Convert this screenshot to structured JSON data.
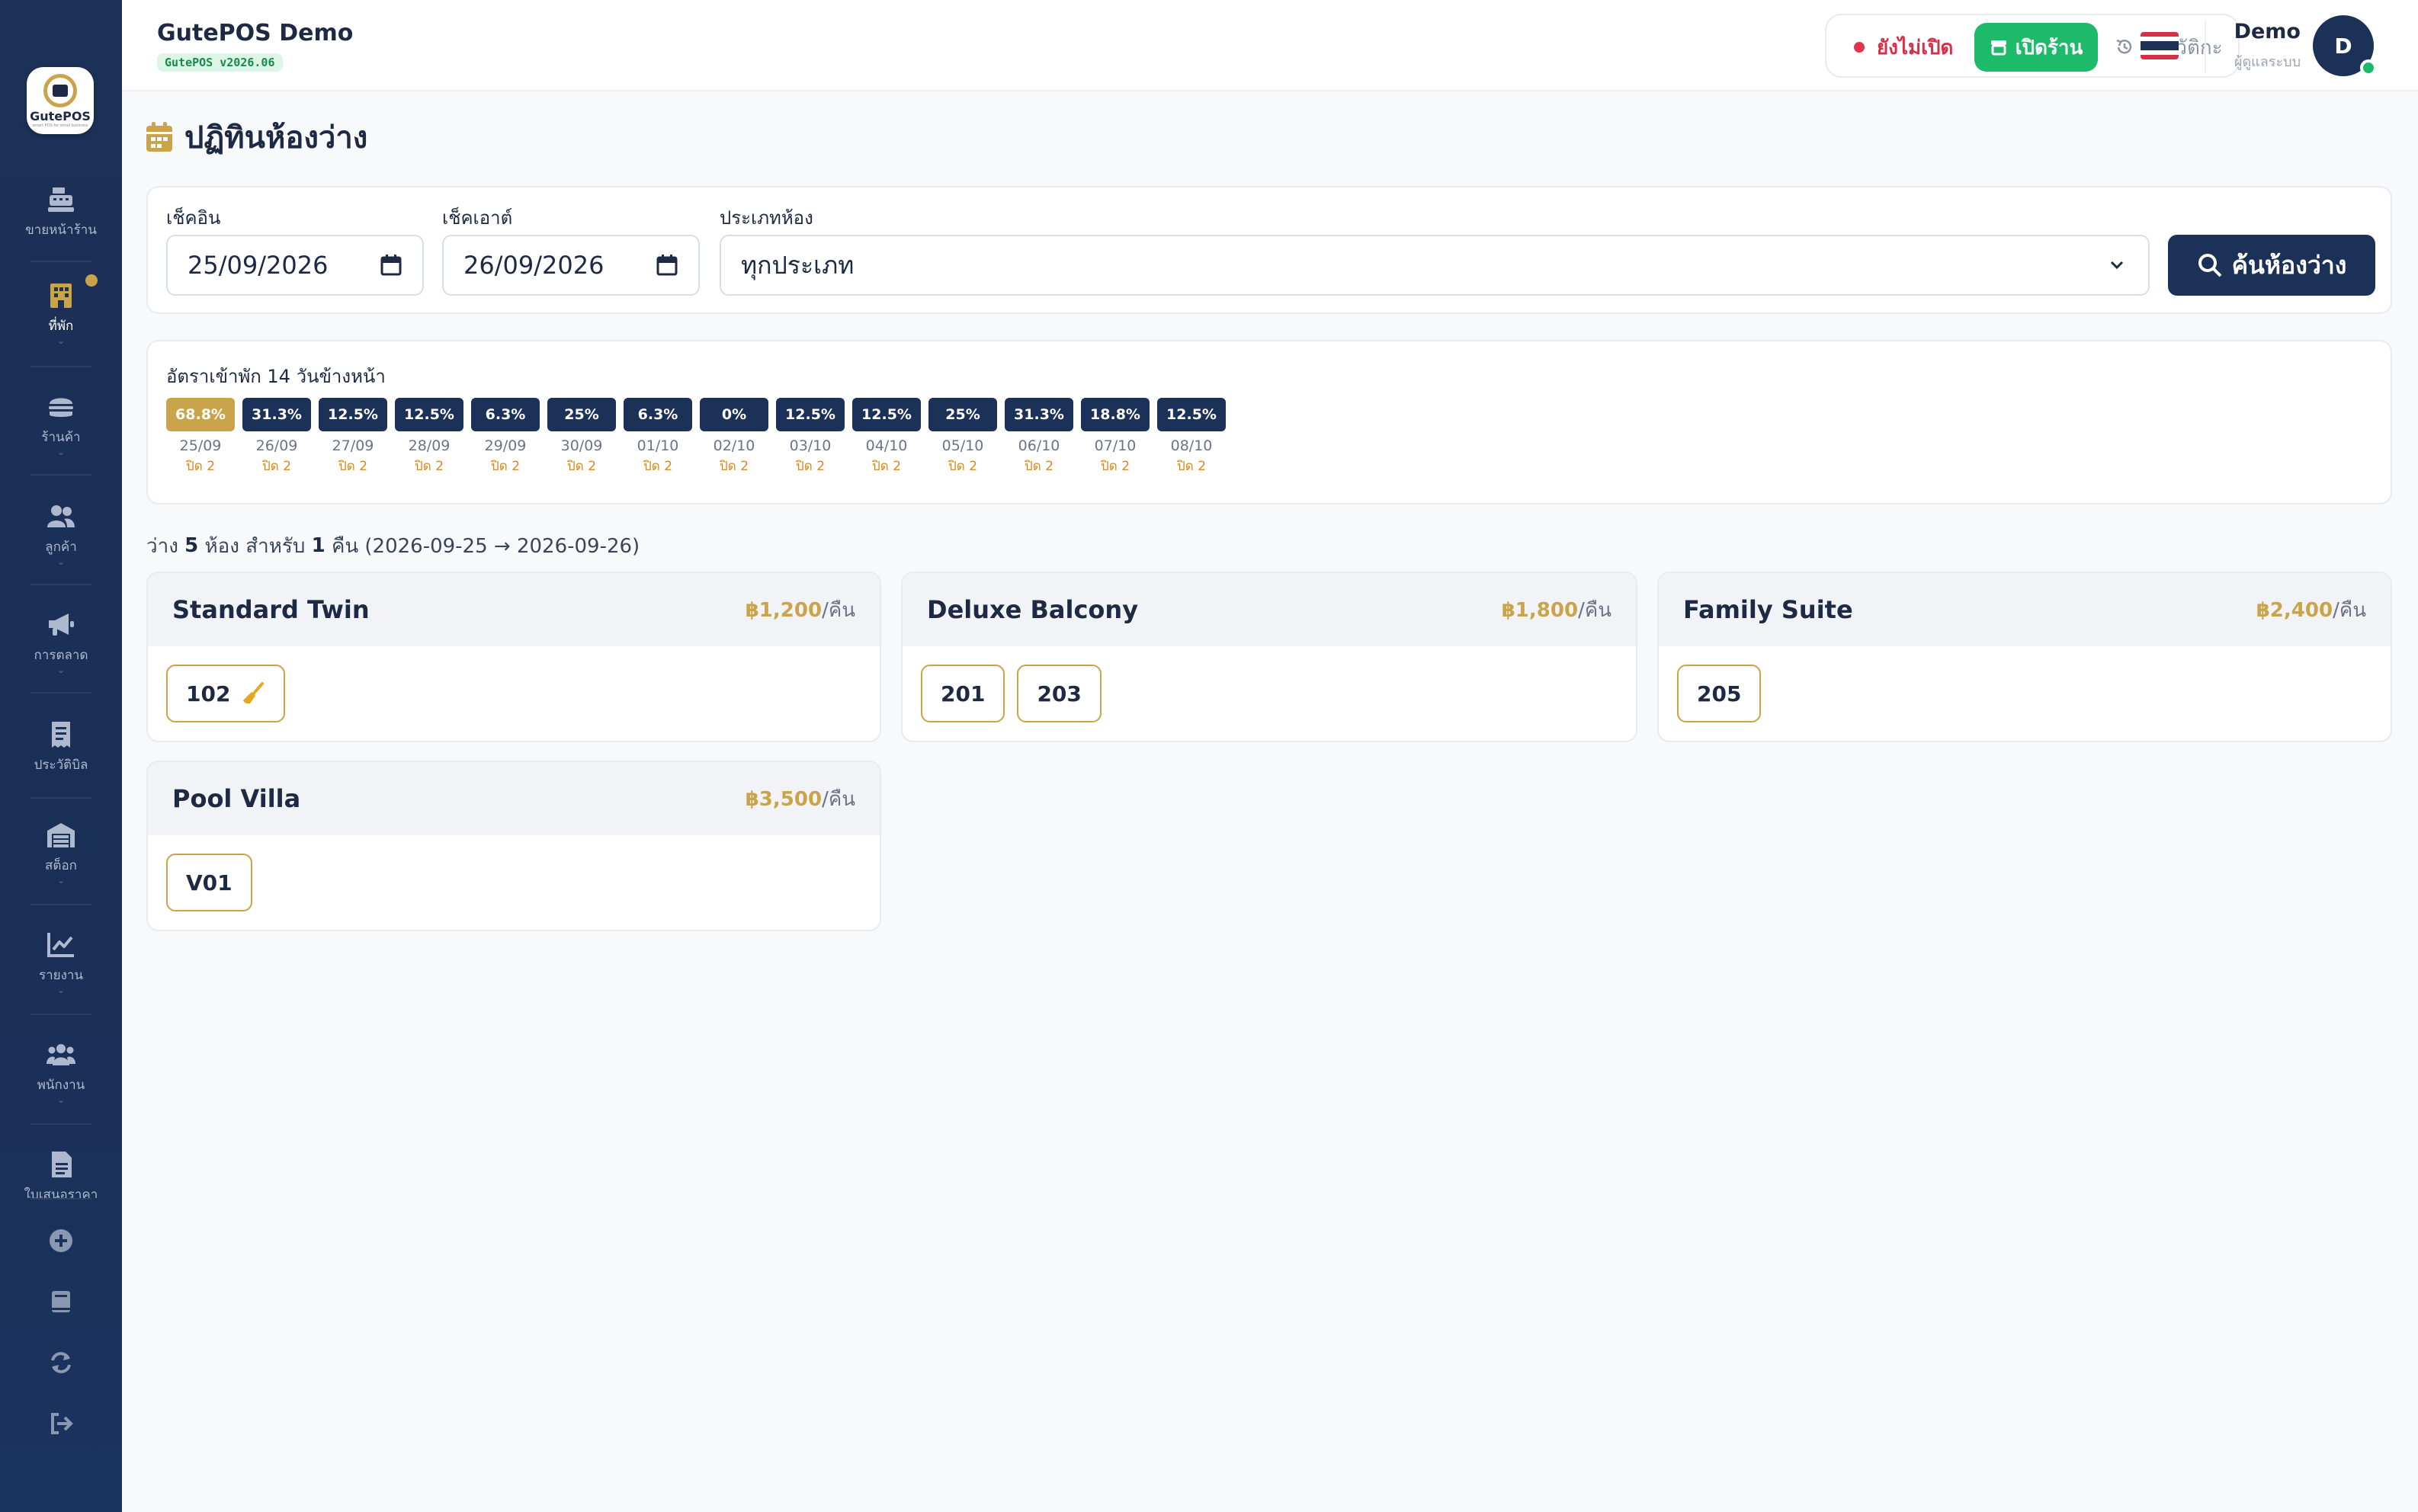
{
  "app": {
    "title": "GutePOS Demo",
    "version": "GutePOS v2026.06",
    "logo_text": "GutePOS",
    "logo_sub": "smart POS for small business"
  },
  "sidebar": {
    "items": [
      {
        "label": "ขายหน้าร้าน",
        "icon": "cash-register-icon"
      },
      {
        "label": "ที่พัก",
        "icon": "hotel-icon",
        "active": true
      },
      {
        "label": "ร้านค้า",
        "icon": "burger-icon"
      },
      {
        "label": "ลูกค้า",
        "icon": "users-icon"
      },
      {
        "label": "การตลาด",
        "icon": "megaphone-icon"
      },
      {
        "label": "ประวัติบิล",
        "icon": "receipt-icon"
      },
      {
        "label": "สต็อก",
        "icon": "warehouse-icon"
      },
      {
        "label": "รายงาน",
        "icon": "chart-line-icon"
      },
      {
        "label": "พนักงาน",
        "icon": "team-icon"
      },
      {
        "label": "ใบเสนอราคา",
        "icon": "document-icon"
      }
    ],
    "utilities": [
      "plus-circle-icon",
      "book-icon",
      "refresh-icon",
      "logout-icon"
    ]
  },
  "topbar": {
    "shop_status": "ยังไม่เปิด",
    "open_shop": "เปิดร้าน",
    "history": "ประวัติกะ",
    "user_name": "Demo",
    "user_role": "ผู้ดูแลระบบ",
    "avatar_initial": "D",
    "flag": "thailand-flag-icon"
  },
  "page": {
    "title": "ปฏิทินห้องว่าง",
    "title_icon": "calendar-icon"
  },
  "filters": {
    "checkin_label": "เช็คอิน",
    "checkin_value": "25/09/2026",
    "checkout_label": "เช็คเอาต์",
    "checkout_value": "26/09/2026",
    "room_type_label": "ประเภทห้อง",
    "room_type_value": "ทุกประเภท",
    "search_button": "ค้นห้องว่าง"
  },
  "occupancy": {
    "title": "อัตราเข้าพัก 14 วันข้างหน้า",
    "days": [
      {
        "pct": "68.8%",
        "date": "25/09",
        "note": "ปิด 2",
        "today": true
      },
      {
        "pct": "31.3%",
        "date": "26/09",
        "note": "ปิด 2"
      },
      {
        "pct": "12.5%",
        "date": "27/09",
        "note": "ปิด 2"
      },
      {
        "pct": "12.5%",
        "date": "28/09",
        "note": "ปิด 2"
      },
      {
        "pct": "6.3%",
        "date": "29/09",
        "note": "ปิด 2"
      },
      {
        "pct": "25%",
        "date": "30/09",
        "note": "ปิด 2"
      },
      {
        "pct": "6.3%",
        "date": "01/10",
        "note": "ปิด 2"
      },
      {
        "pct": "0%",
        "date": "02/10",
        "note": "ปิด 2"
      },
      {
        "pct": "12.5%",
        "date": "03/10",
        "note": "ปิด 2"
      },
      {
        "pct": "12.5%",
        "date": "04/10",
        "note": "ปิด 2"
      },
      {
        "pct": "25%",
        "date": "05/10",
        "note": "ปิด 2"
      },
      {
        "pct": "31.3%",
        "date": "06/10",
        "note": "ปิด 2"
      },
      {
        "pct": "18.8%",
        "date": "07/10",
        "note": "ปิด 2"
      },
      {
        "pct": "12.5%",
        "date": "08/10",
        "note": "ปิด 2"
      }
    ]
  },
  "summary": {
    "prefix": "ว่าง ",
    "count": "5",
    "mid": " ห้อง สำหรับ ",
    "nights": "1",
    "suffix": " คืน (2026-09-25 → 2026-09-26)"
  },
  "rooms": [
    {
      "name": "Standard Twin",
      "price": "฿1,200",
      "unit": "/คืน",
      "chips": [
        {
          "no": "102",
          "cleaning": true
        }
      ]
    },
    {
      "name": "Deluxe Balcony",
      "price": "฿1,800",
      "unit": "/คืน",
      "chips": [
        {
          "no": "201"
        },
        {
          "no": "203"
        }
      ]
    },
    {
      "name": "Family Suite",
      "price": "฿2,400",
      "unit": "/คืน",
      "chips": [
        {
          "no": "205"
        }
      ]
    },
    {
      "name": "Pool Villa",
      "price": "฿3,500",
      "unit": "/คืน",
      "chips": [
        {
          "no": "V01"
        }
      ]
    }
  ],
  "colors": {
    "navy": "#1c3157",
    "gold": "#c9a44a",
    "green": "#1dba6a",
    "red": "#e2334f"
  }
}
